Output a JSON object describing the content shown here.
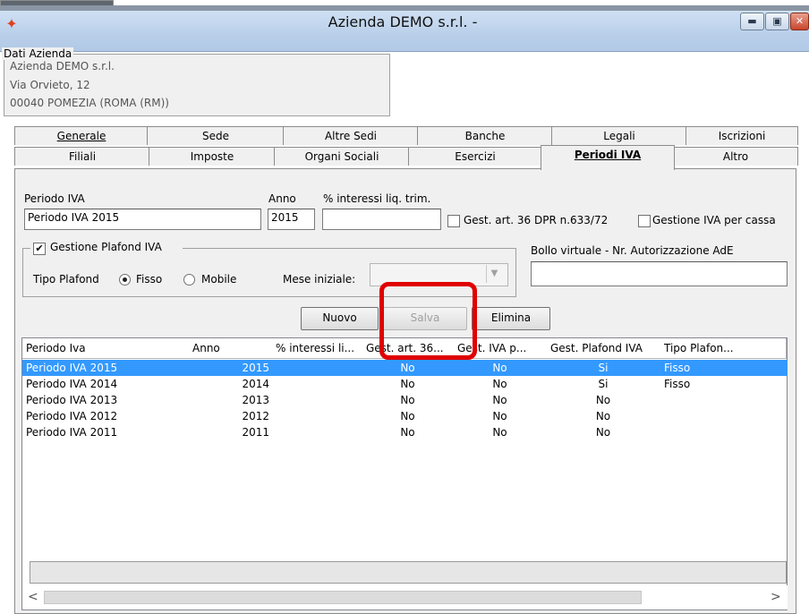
{
  "window": {
    "title": "Azienda DEMO s.r.l. -",
    "minimize_label": "▬",
    "maximize_label": "▣",
    "close_label": "✕"
  },
  "company": {
    "legend": "Dati Azienda",
    "name": "Azienda DEMO s.r.l.",
    "address": "Via Orvieto, 12",
    "city": "00040  POMEZIA  (ROMA (RM))"
  },
  "tabs_row1": [
    "Generale",
    "Sede",
    "Altre Sedi",
    "Banche",
    "Legali",
    "Iscrizioni"
  ],
  "tabs_row2": [
    "Filiali",
    "Imposte",
    "Organi Sociali",
    "Esercizi",
    "Periodi IVA",
    "Altro"
  ],
  "form": {
    "periodo_label": "Periodo IVA",
    "periodo_value": "Periodo IVA 2015",
    "anno_label": "Anno",
    "anno_value": "2015",
    "interessi_label": "% interessi liq. trim.",
    "interessi_value": "",
    "gest_art36_label": "Gest. art. 36 DPR n.633/72",
    "gest_cassa_label": "Gestione IVA per cassa",
    "plafond_legend": "Gestione Plafond IVA",
    "tipo_plafond_label": "Tipo Plafond",
    "fisso_label": "Fisso",
    "mobile_label": "Mobile",
    "mese_label": "Mese iniziale:",
    "mese_value": "",
    "bollo_label": "Bollo virtuale - Nr. Autorizzazione AdE",
    "bollo_value": "",
    "nuovo_label": "Nuovo",
    "salva_label": "Salva",
    "elimina_label": "Elimina"
  },
  "grid": {
    "columns": [
      "Periodo Iva",
      "Anno",
      "% interessi li...",
      "Gest. art. 36...",
      "Gest. IVA p...",
      "Gest. Plafond IVA",
      "Tipo Plafon..."
    ],
    "rows": [
      [
        "Periodo IVA 2015",
        "2015",
        "",
        "No",
        "No",
        "Si",
        "Fisso"
      ],
      [
        "Periodo IVA 2014",
        "2014",
        "",
        "No",
        "No",
        "Si",
        "Fisso"
      ],
      [
        "Periodo IVA 2013",
        "2013",
        "",
        "No",
        "No",
        "No",
        ""
      ],
      [
        "Periodo IVA 2012",
        "2012",
        "",
        "No",
        "No",
        "No",
        ""
      ],
      [
        "Periodo IVA 2011",
        "2011",
        "",
        "No",
        "No",
        "No",
        ""
      ]
    ],
    "scroll_left": "<",
    "scroll_right": ">"
  },
  "colors": {
    "selection": "#3399ff",
    "highlight": "#e00000"
  }
}
